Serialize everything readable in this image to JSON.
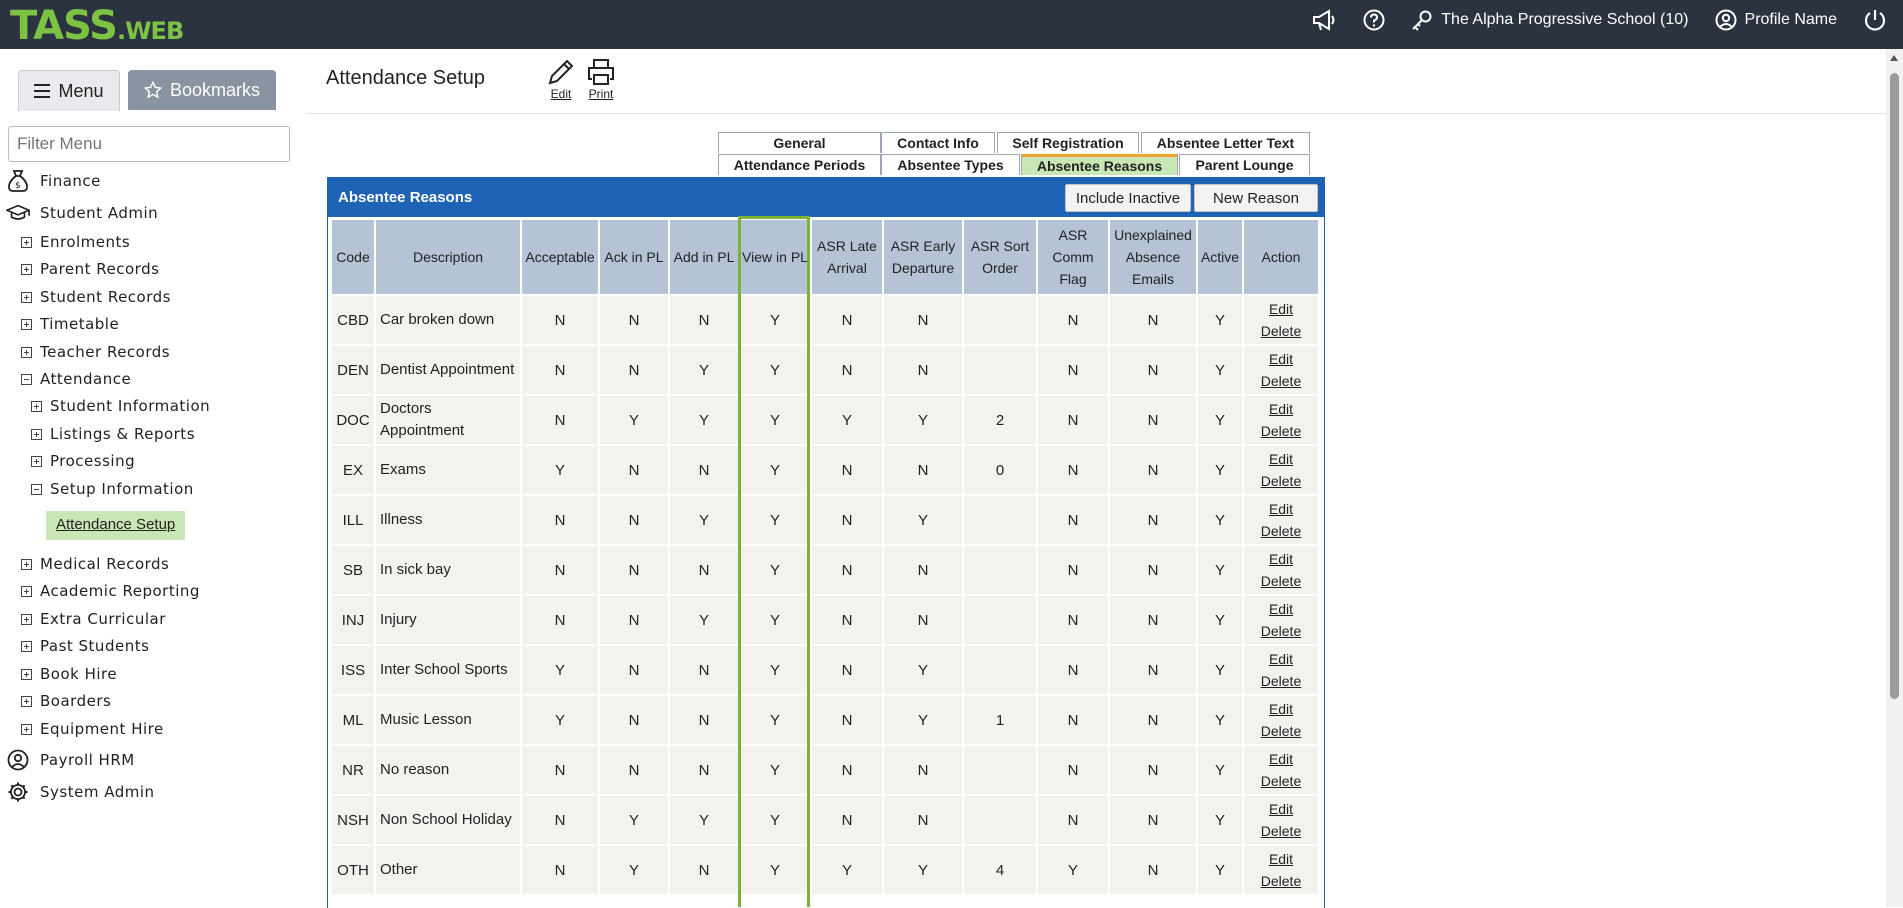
{
  "topbar": {
    "logo_main": "TASS",
    "logo_suffix": ".WEB",
    "school": "The Alpha Progressive School (10)",
    "profile": "Profile Name"
  },
  "sidebar": {
    "menu_tab": "Menu",
    "bookmarks_tab": "Bookmarks",
    "filter_placeholder": "Filter Menu",
    "items": [
      {
        "label": "Finance"
      },
      {
        "label": "Student Admin"
      },
      {
        "label": "Enrolments"
      },
      {
        "label": "Parent Records"
      },
      {
        "label": "Student Records"
      },
      {
        "label": "Timetable"
      },
      {
        "label": "Teacher Records"
      },
      {
        "label": "Attendance"
      },
      {
        "label": "Student Information"
      },
      {
        "label": "Listings & Reports"
      },
      {
        "label": "Processing"
      },
      {
        "label": "Setup Information"
      },
      {
        "label": "Attendance Setup"
      },
      {
        "label": "Medical Records"
      },
      {
        "label": "Academic Reporting"
      },
      {
        "label": "Extra Curricular"
      },
      {
        "label": "Past Students"
      },
      {
        "label": "Book Hire"
      },
      {
        "label": "Boarders"
      },
      {
        "label": "Equipment Hire"
      },
      {
        "label": "Payroll HRM"
      },
      {
        "label": "System Admin"
      }
    ]
  },
  "header": {
    "title": "Attendance Setup",
    "edit_label": "Edit",
    "print_label": "Print"
  },
  "tabs": {
    "general": "General",
    "contact_info": "Contact Info",
    "self_registration": "Self Registration",
    "absentee_letter_text": "Absentee Letter Text",
    "attendance_periods": "Attendance Periods",
    "absentee_types": "Absentee Types",
    "absentee_reasons": "Absentee Reasons",
    "parent_lounge": "Parent Lounge"
  },
  "panel": {
    "title": "Absentee Reasons",
    "include_inactive": "Include Inactive",
    "new_reason": "New Reason"
  },
  "table": {
    "headers": {
      "code": "Code",
      "description": "Description",
      "acceptable": "Acceptable",
      "ack_pl": "Ack in PL",
      "add_pl": "Add in PL",
      "view_pl": "View in PL",
      "asr_late": "ASR Late Arrival",
      "asr_early": "ASR Early Departure",
      "asr_sort": "ASR Sort Order",
      "asr_comm": "ASR Comm Flag",
      "unexplained": "Unexplained Absence Emails",
      "active": "Active",
      "action": "Action"
    },
    "edit": "Edit",
    "delete": "Delete",
    "rows": [
      [
        "CBD",
        "Car broken down",
        "N",
        "N",
        "N",
        "Y",
        "N",
        "N",
        "",
        "N",
        "N",
        "Y"
      ],
      [
        "DEN",
        "Dentist Appointment",
        "N",
        "N",
        "Y",
        "Y",
        "N",
        "N",
        "",
        "N",
        "N",
        "Y"
      ],
      [
        "DOC",
        "Doctors Appointment",
        "N",
        "Y",
        "Y",
        "Y",
        "Y",
        "Y",
        "2",
        "N",
        "N",
        "Y"
      ],
      [
        "EX",
        "Exams",
        "Y",
        "N",
        "N",
        "Y",
        "N",
        "N",
        "0",
        "N",
        "N",
        "Y"
      ],
      [
        "ILL",
        "Illness",
        "N",
        "N",
        "Y",
        "Y",
        "N",
        "Y",
        "",
        "N",
        "N",
        "Y"
      ],
      [
        "SB",
        "In sick bay",
        "N",
        "N",
        "N",
        "Y",
        "N",
        "N",
        "",
        "N",
        "N",
        "Y"
      ],
      [
        "INJ",
        "Injury",
        "N",
        "N",
        "Y",
        "Y",
        "N",
        "N",
        "",
        "N",
        "N",
        "Y"
      ],
      [
        "ISS",
        "Inter School Sports",
        "Y",
        "N",
        "N",
        "Y",
        "N",
        "Y",
        "",
        "N",
        "N",
        "Y"
      ],
      [
        "ML",
        "Music Lesson",
        "Y",
        "N",
        "N",
        "Y",
        "N",
        "Y",
        "1",
        "N",
        "N",
        "Y"
      ],
      [
        "NR",
        "No reason",
        "N",
        "N",
        "N",
        "Y",
        "N",
        "N",
        "",
        "N",
        "N",
        "Y"
      ],
      [
        "NSH",
        "Non School Holiday",
        "N",
        "Y",
        "Y",
        "Y",
        "N",
        "N",
        "",
        "N",
        "N",
        "Y"
      ],
      [
        "OTH",
        "Other",
        "N",
        "Y",
        "N",
        "Y",
        "Y",
        "Y",
        "4",
        "Y",
        "N",
        "Y"
      ]
    ]
  },
  "colors": {
    "topbar": "#2c3340",
    "logo_green": "#7cc243",
    "panel_blue": "#1e63b6",
    "header_cell": "#b4c4d6",
    "highlight": "#79b33a",
    "active_tab": "#c9e7b4"
  }
}
